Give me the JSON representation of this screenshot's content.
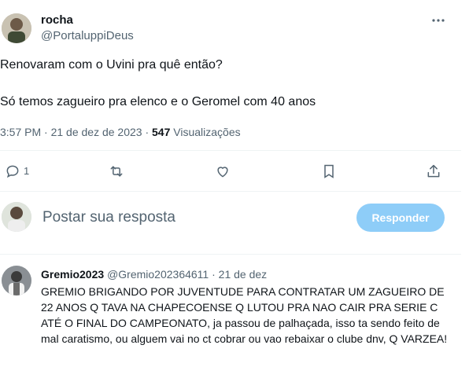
{
  "tweet": {
    "display_name": "rocha",
    "handle": "@PortaluppiDeus",
    "text_line1": "Renovaram com o Uvini pra quê então?",
    "text_line2": "Só temos zagueiro pra elenco e o Geromel com 40 anos",
    "timestamp": "3:57 PM · 21 de dez de 2023 ·",
    "views_count": "547",
    "views_label": "Visualizações",
    "reply_count": "1"
  },
  "composer": {
    "placeholder": "Postar sua resposta",
    "button_label": "Responder"
  },
  "reply": {
    "display_name": "Gremio2023",
    "handle": "@Gremio202364611",
    "date": "· 21 de dez",
    "text": "GREMIO BRIGANDO POR JUVENTUDE PARA CONTRATAR UM ZAGUEIRO DE 22 ANOS Q TAVA NA CHAPECOENSE Q LUTOU PRA NAO CAIR PRA SERIE C ATÉ O FINAL DO CAMPEONATO, ja passou de palhaçada, isso ta sendo feito de mal caratismo, ou alguem vai no ct cobrar ou vao rebaixar o clube dnv, Q VARZEA!"
  },
  "icons": [
    "more-icon",
    "reply-icon",
    "retweet-icon",
    "like-icon",
    "bookmark-icon",
    "share-icon"
  ]
}
